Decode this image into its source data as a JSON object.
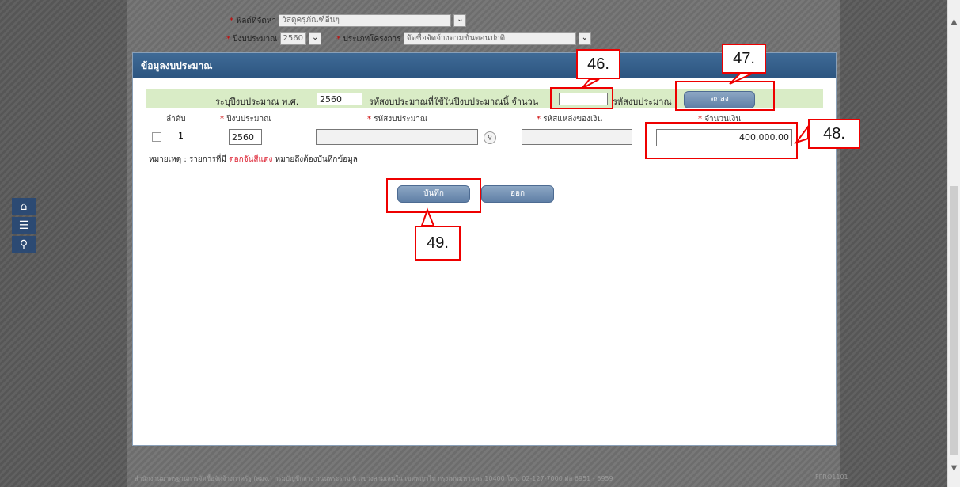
{
  "background_form": {
    "supply_method_label": "ฟิลด์ที่จัดหา",
    "supply_method_value": "วัสดุครุภัณฑ์อื่นๆ",
    "budget_year_label": "ปีงบประมาณ",
    "budget_year_value": "2560",
    "project_type_label": "ประเภทโครงการ",
    "project_type_value": "จัดซื้อจัดจ้างตามขั้นตอนปกติ"
  },
  "modal": {
    "title": "ข้อมูลงบประมาณ",
    "filter": {
      "year_prefix": "ระบุปีงบประมาณ พ.ศ.",
      "year_value": "2560",
      "count_prefix": "รหัสงบประมาณที่ใช้ในปีงบประมาณนี้ จำนวน",
      "count_value": "",
      "count_suffix": "รหัสงบประมาณ",
      "ok_label": "ตกลง"
    },
    "table": {
      "headers": [
        "ลำดับ",
        "ปีงบประมาณ",
        "รหัสงบประมาณ",
        "รหัสแหล่งของเงิน",
        "จำนวนเงิน"
      ],
      "rows": [
        {
          "no": "1",
          "year": "2560",
          "budget_code": "",
          "source_code": "",
          "amount": "400,000.00"
        }
      ]
    },
    "note_prefix": "หมายเหตุ : รายการที่มี",
    "note_highlight": "ดอกจันสีแดง",
    "note_suffix": "หมายถึงต้องบันทึกข้อมูล",
    "save_label": "บันทึก",
    "exit_label": "ออก"
  },
  "callouts": {
    "c46": "46.",
    "c47": "47.",
    "c48": "48.",
    "c49": "49."
  },
  "footer": {
    "text": "สำนักงานมาตรฐานการจัดซื้อจัดจ้างภาครัฐ (สมจ.) กรมบัญชีกลาง ถนนพระราม 6 แขวงสามเสนใน เขตพญาไท กรุงเทพมหานคร 10400 โทร. 02-127-7000 ต่อ 6951 - 6959",
    "code": "FPRO1101"
  },
  "left_nav": [
    "home-icon",
    "menu-icon",
    "search-icon"
  ],
  "colors": {
    "accent": "#2c5580",
    "required": "#cc0000",
    "callout": "#ee0000"
  }
}
